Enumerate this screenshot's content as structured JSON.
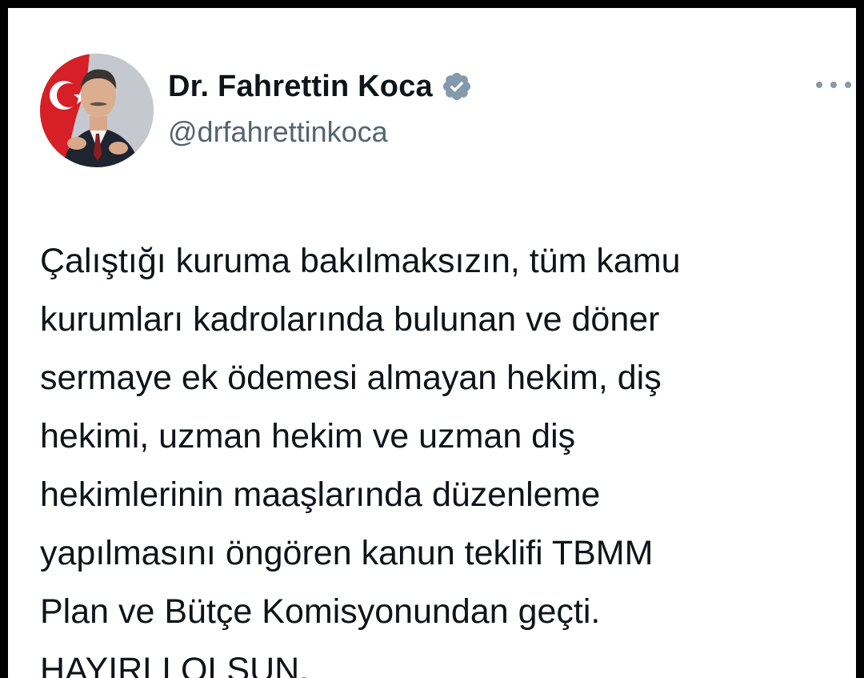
{
  "tweet": {
    "author": {
      "display_name": "Dr. Fahrettin Koca",
      "handle": "@drfahrettinkoca",
      "verified_icon": "verified-badge-icon",
      "avatar_icon": "profile-photo"
    },
    "more_icon": "more-horizontal-icon",
    "text_lines": [
      "Çalıştığı kuruma bakılmaksızın, tüm kamu",
      "kurumları kadrolarında bulunan ve döner",
      "sermaye ek ödemesi almayan hekim, diş",
      "hekimi, uzman hekim ve uzman diş",
      "hekimlerinin maaşlarında düzenleme",
      "yapılmasını öngören kanun teklifi TBMM",
      "Plan ve Bütçe Komisyonundan geçti.",
      "HAYIRLI OLSUN."
    ]
  },
  "colors": {
    "text_primary": "#0f1419",
    "text_secondary": "#536471",
    "verified_badge": "#829aab",
    "background": "#ffffff"
  }
}
